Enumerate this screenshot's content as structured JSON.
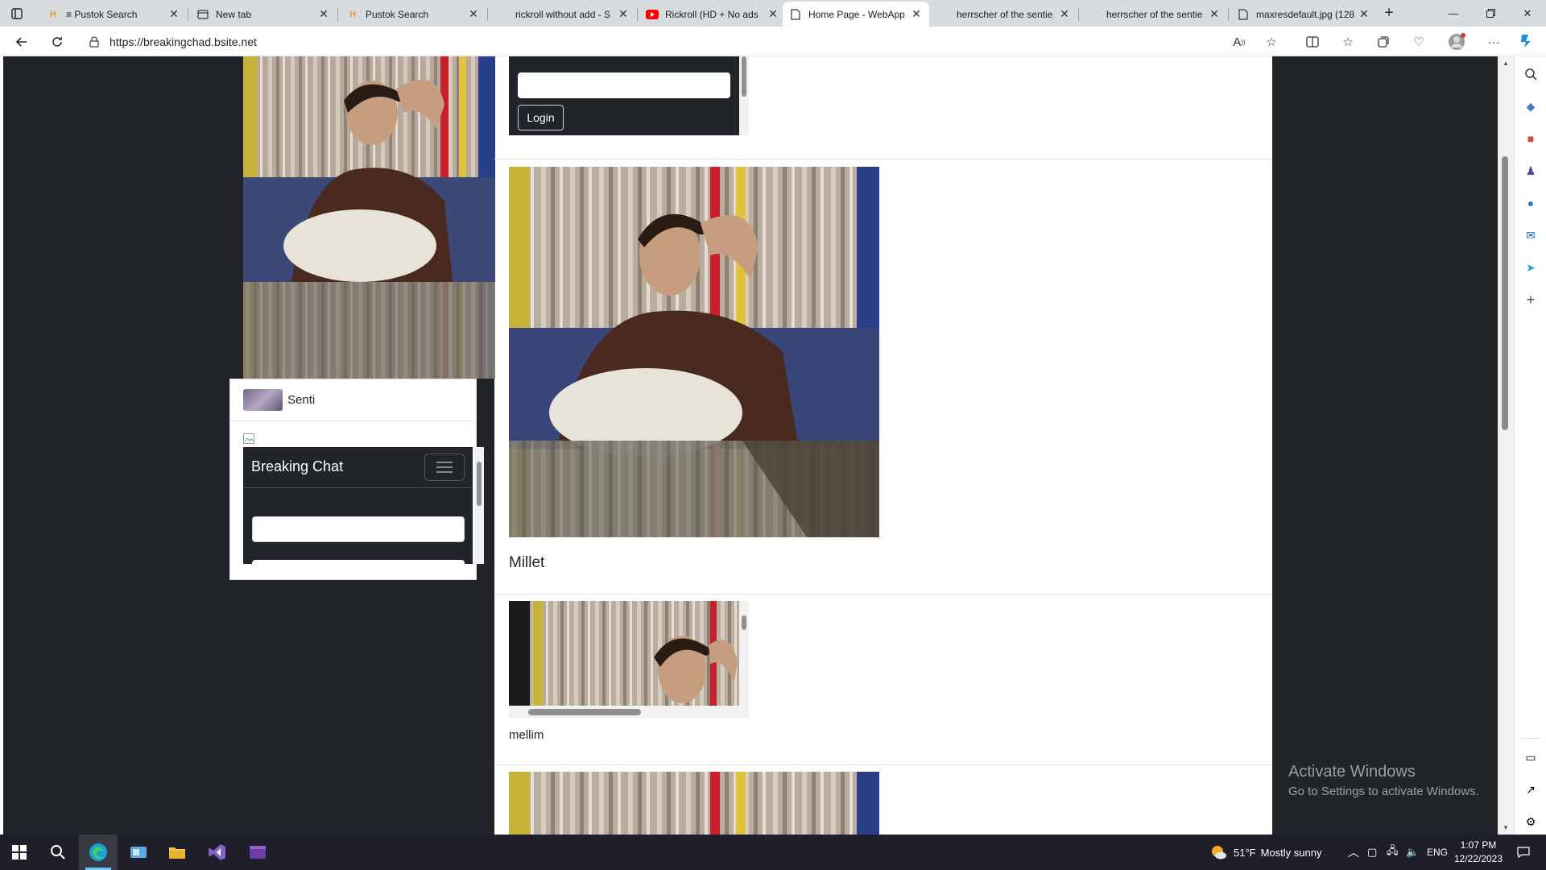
{
  "browser": {
    "tabs": [
      {
        "label": "≡ Pustok Search",
        "icon": "h-logo-icon",
        "active": false
      },
      {
        "label": "New tab",
        "icon": "newtab-icon",
        "active": false
      },
      {
        "label": "Pustok Search",
        "icon": "h-logo-icon",
        "active": false
      },
      {
        "label": "rickroll without add - S",
        "icon": "",
        "active": false
      },
      {
        "label": "Rickroll (HD + No ads",
        "icon": "youtube-icon",
        "active": false
      },
      {
        "label": "Home Page - WebApp",
        "icon": "page-icon",
        "active": true
      },
      {
        "label": "herrscher of the sentie",
        "icon": "",
        "active": false
      },
      {
        "label": "herrscher of the sentie",
        "icon": "",
        "active": false
      },
      {
        "label": "maxresdefault.jpg (128",
        "icon": "page-icon",
        "active": false
      }
    ],
    "new_tab_symbol": "+",
    "url": "https://breakingchad.bsite.net"
  },
  "page": {
    "login_button": "Login",
    "sidebar_user": "Senti",
    "chat_brand": "Breaking Chat",
    "post_title": "Millet",
    "post2_caption": "mellim"
  },
  "watermark": {
    "line1": "Activate Windows",
    "line2": "Go to Settings to activate Windows."
  },
  "taskbar": {
    "weather_temp": "51°F",
    "weather_text": "Mostly sunny",
    "language": "ENG",
    "time": "1:07 PM",
    "date": "12/22/2023"
  },
  "colors": {
    "page_dark": "#212529",
    "taskbar": "#1f1f2b",
    "accent": "#60cdff"
  }
}
